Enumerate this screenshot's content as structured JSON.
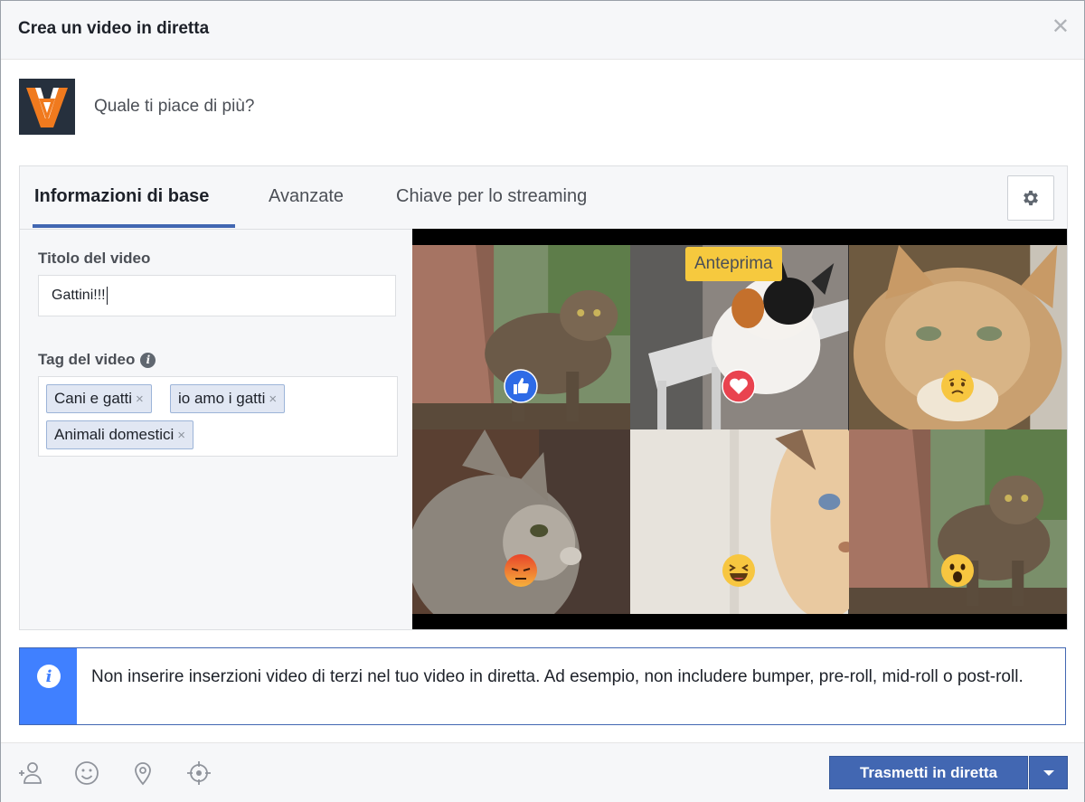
{
  "dialog": {
    "title": "Crea un video in diretta",
    "close_icon": "close-icon"
  },
  "composer": {
    "prompt": "Quale ti piace di più?"
  },
  "tabs": [
    {
      "label": "Informazioni di base",
      "active": true
    },
    {
      "label": "Avanzate",
      "active": false
    },
    {
      "label": "Chiave per lo streaming",
      "active": false
    }
  ],
  "form": {
    "title_label": "Titolo del video",
    "title_value": "Gattini!!!",
    "tags_label": "Tag del video",
    "tags": [
      "Cani e gatti",
      "io amo i gatti",
      "Animali domestici"
    ],
    "tag_remove": "×"
  },
  "preview": {
    "badge": "Anteprima",
    "reactions": [
      "like-icon",
      "love-icon",
      "sad-icon",
      "angry-icon",
      "haha-icon",
      "wow-icon"
    ]
  },
  "notice": {
    "text": "Non inserire inserzioni video di terzi nel tuo video in diretta. Ad esempio, non includere bumper, pre-roll, mid-roll o post-roll."
  },
  "footer": {
    "go_live_label": "Trasmetti in diretta"
  },
  "colors": {
    "brand": "#4267b2",
    "info_blue": "#4080ff",
    "badge_yellow": "#f6c93e"
  }
}
